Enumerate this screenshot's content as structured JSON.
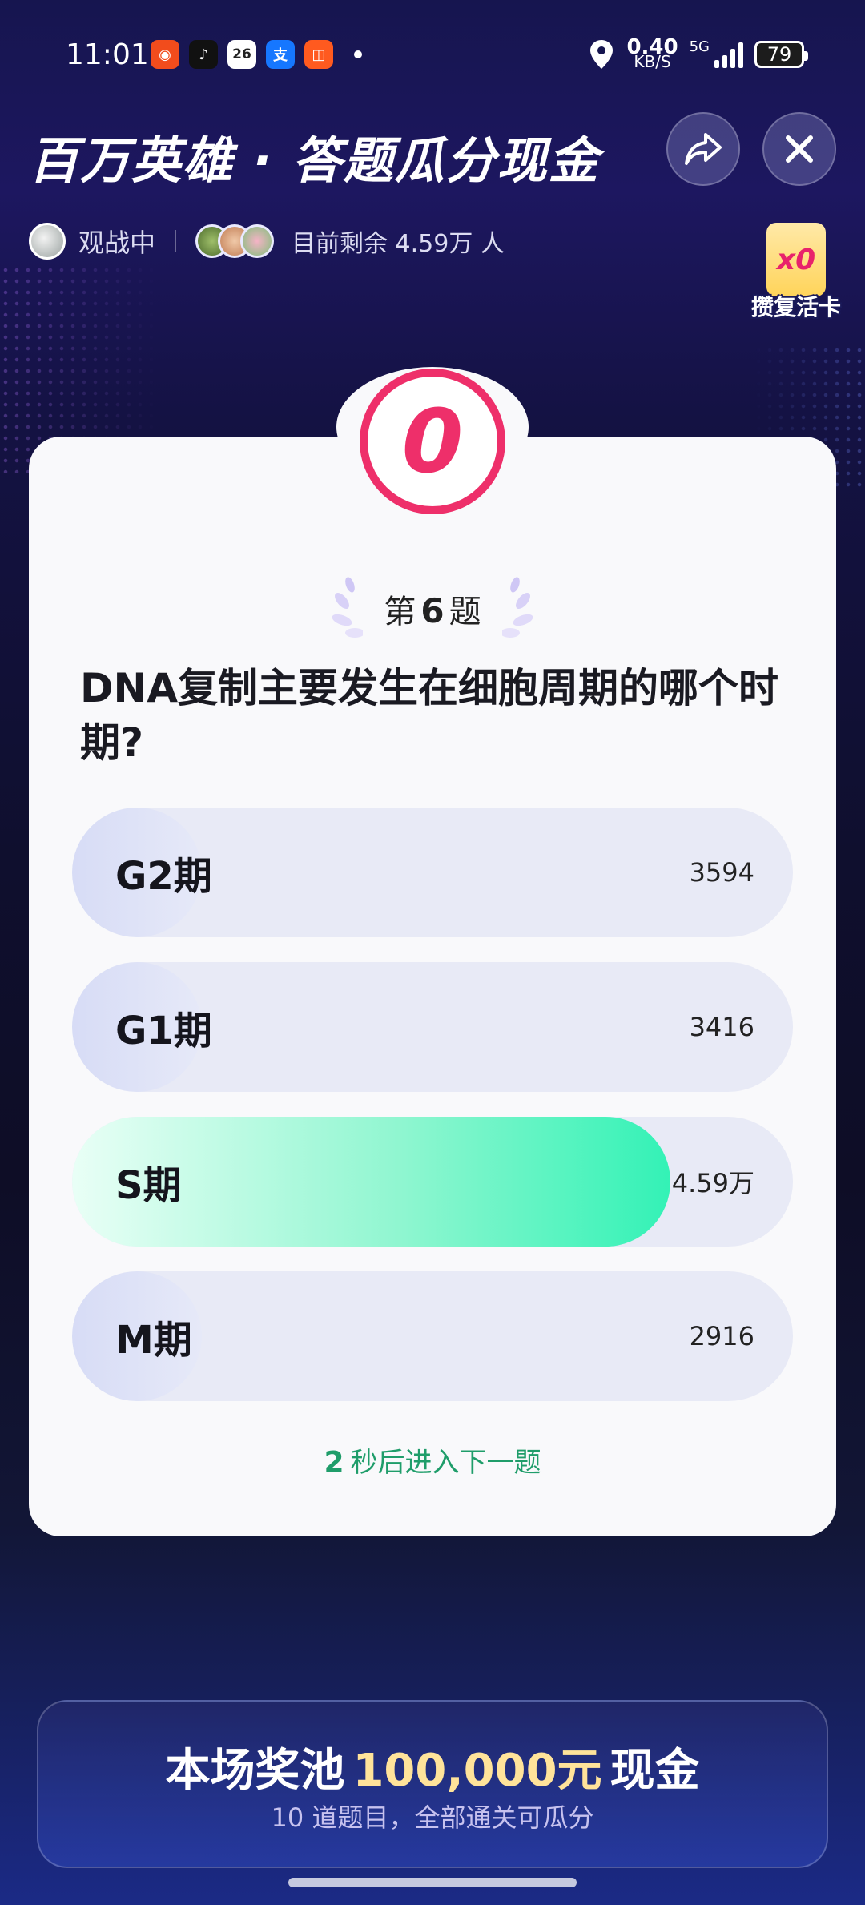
{
  "status": {
    "time": "11:01",
    "date_badge": "26",
    "net_speed_value": "0.40",
    "net_speed_unit": "KB/S",
    "network_type": "5G",
    "battery": "79"
  },
  "header": {
    "title": "百万英雄 · 答题瓜分现金",
    "watching": "观战中",
    "remaining": "目前剩余 4.59万 人"
  },
  "revive_card": {
    "count": "x0",
    "label": "攒复活卡"
  },
  "timer": {
    "value": "0"
  },
  "question": {
    "number_prefix": "第",
    "number": "6",
    "number_suffix": "题",
    "text": "DNA复制主要发生在细胞周期的哪个时期?"
  },
  "options": [
    {
      "label": "G2期",
      "count": "3594",
      "share": 0.07,
      "correct": false
    },
    {
      "label": "G1期",
      "count": "3416",
      "share": 0.07,
      "correct": false
    },
    {
      "label": "S期",
      "count": "4.59万",
      "share": 0.83,
      "correct": true
    },
    {
      "label": "M期",
      "count": "2916",
      "share": 0.06,
      "correct": false
    }
  ],
  "next_hint": {
    "seconds": "2",
    "text": "秒后进入下一题"
  },
  "prize_pool": {
    "prefix": "本场奖池",
    "amount": "100,000元",
    "suffix": "现金",
    "subtitle": "10 道题目，全部通关可瓜分"
  },
  "colors": {
    "accent_pink": "#ee2f6a",
    "correct_green": "#33f2b6",
    "hint_green": "#1f9d6a",
    "prize_gold": "#ffe39a"
  }
}
